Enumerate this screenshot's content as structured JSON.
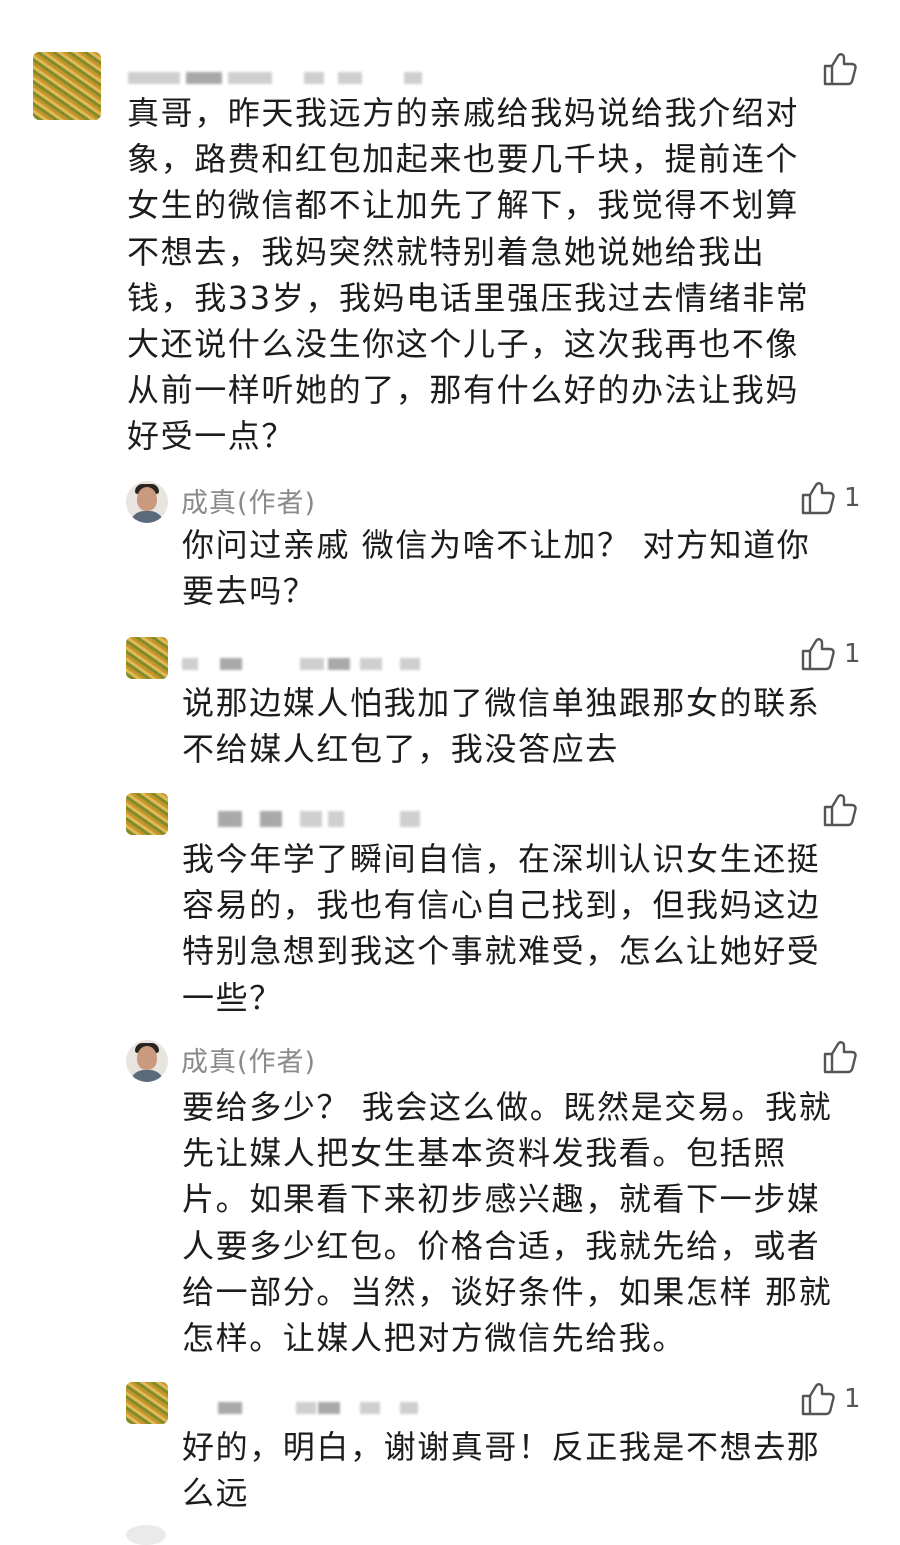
{
  "comments": [
    {
      "role": "top",
      "name": "",
      "text": "真哥，昨天我远方的亲戚给我妈说给我介绍对\n象，路费和红包加起来也要几千块，提前连个\n女生的微信都不让加先了解下，我觉得不划算\n不想去，我妈突然就特别着急她说她给我出\n钱，我33岁，我妈电话里强压我过去情绪非常\n大还说什么没生你这个儿子，这次我再也不像\n从前一样听她的了，那有什么好的办法让我妈\n好受一点？",
      "likes": ""
    },
    {
      "role": "author",
      "name": "成真(作者)",
      "text": "你问过亲戚 微信为啥不让加？ 对方知道你\n要去吗？",
      "likes": "1"
    },
    {
      "role": "user",
      "name": "",
      "text": "说那边媒人怕我加了微信单独跟那女的联系\n不给媒人红包了，我没答应去",
      "likes": "1"
    },
    {
      "role": "user",
      "name": "",
      "text": "我今年学了瞬间自信，在深圳认识女生还挺\n容易的，我也有信心自己找到，但我妈这边\n特别急想到我这个事就难受，怎么让她好受\n一些？",
      "likes": ""
    },
    {
      "role": "author",
      "name": "成真(作者)",
      "text": "要给多少？ 我会这么做。既然是交易。我就\n先让媒人把女生基本资料发我看。包括照\n片。如果看下来初步感兴趣，就看下一步媒\n人要多少红包。价格合适，我就先给，或者\n给一部分。当然，谈好条件，如果怎样 那就\n怎样。让媒人把对方微信先给我。",
      "likes": ""
    },
    {
      "role": "user",
      "name": "",
      "text": "好的，明白，谢谢真哥！反正我是不想去那\n么远",
      "likes": "1"
    }
  ],
  "icons": {
    "like": "thumbs-up-icon"
  },
  "colors": {
    "text": "#1c1c1c",
    "meta": "#8a8a8a",
    "icon": "#555555"
  }
}
